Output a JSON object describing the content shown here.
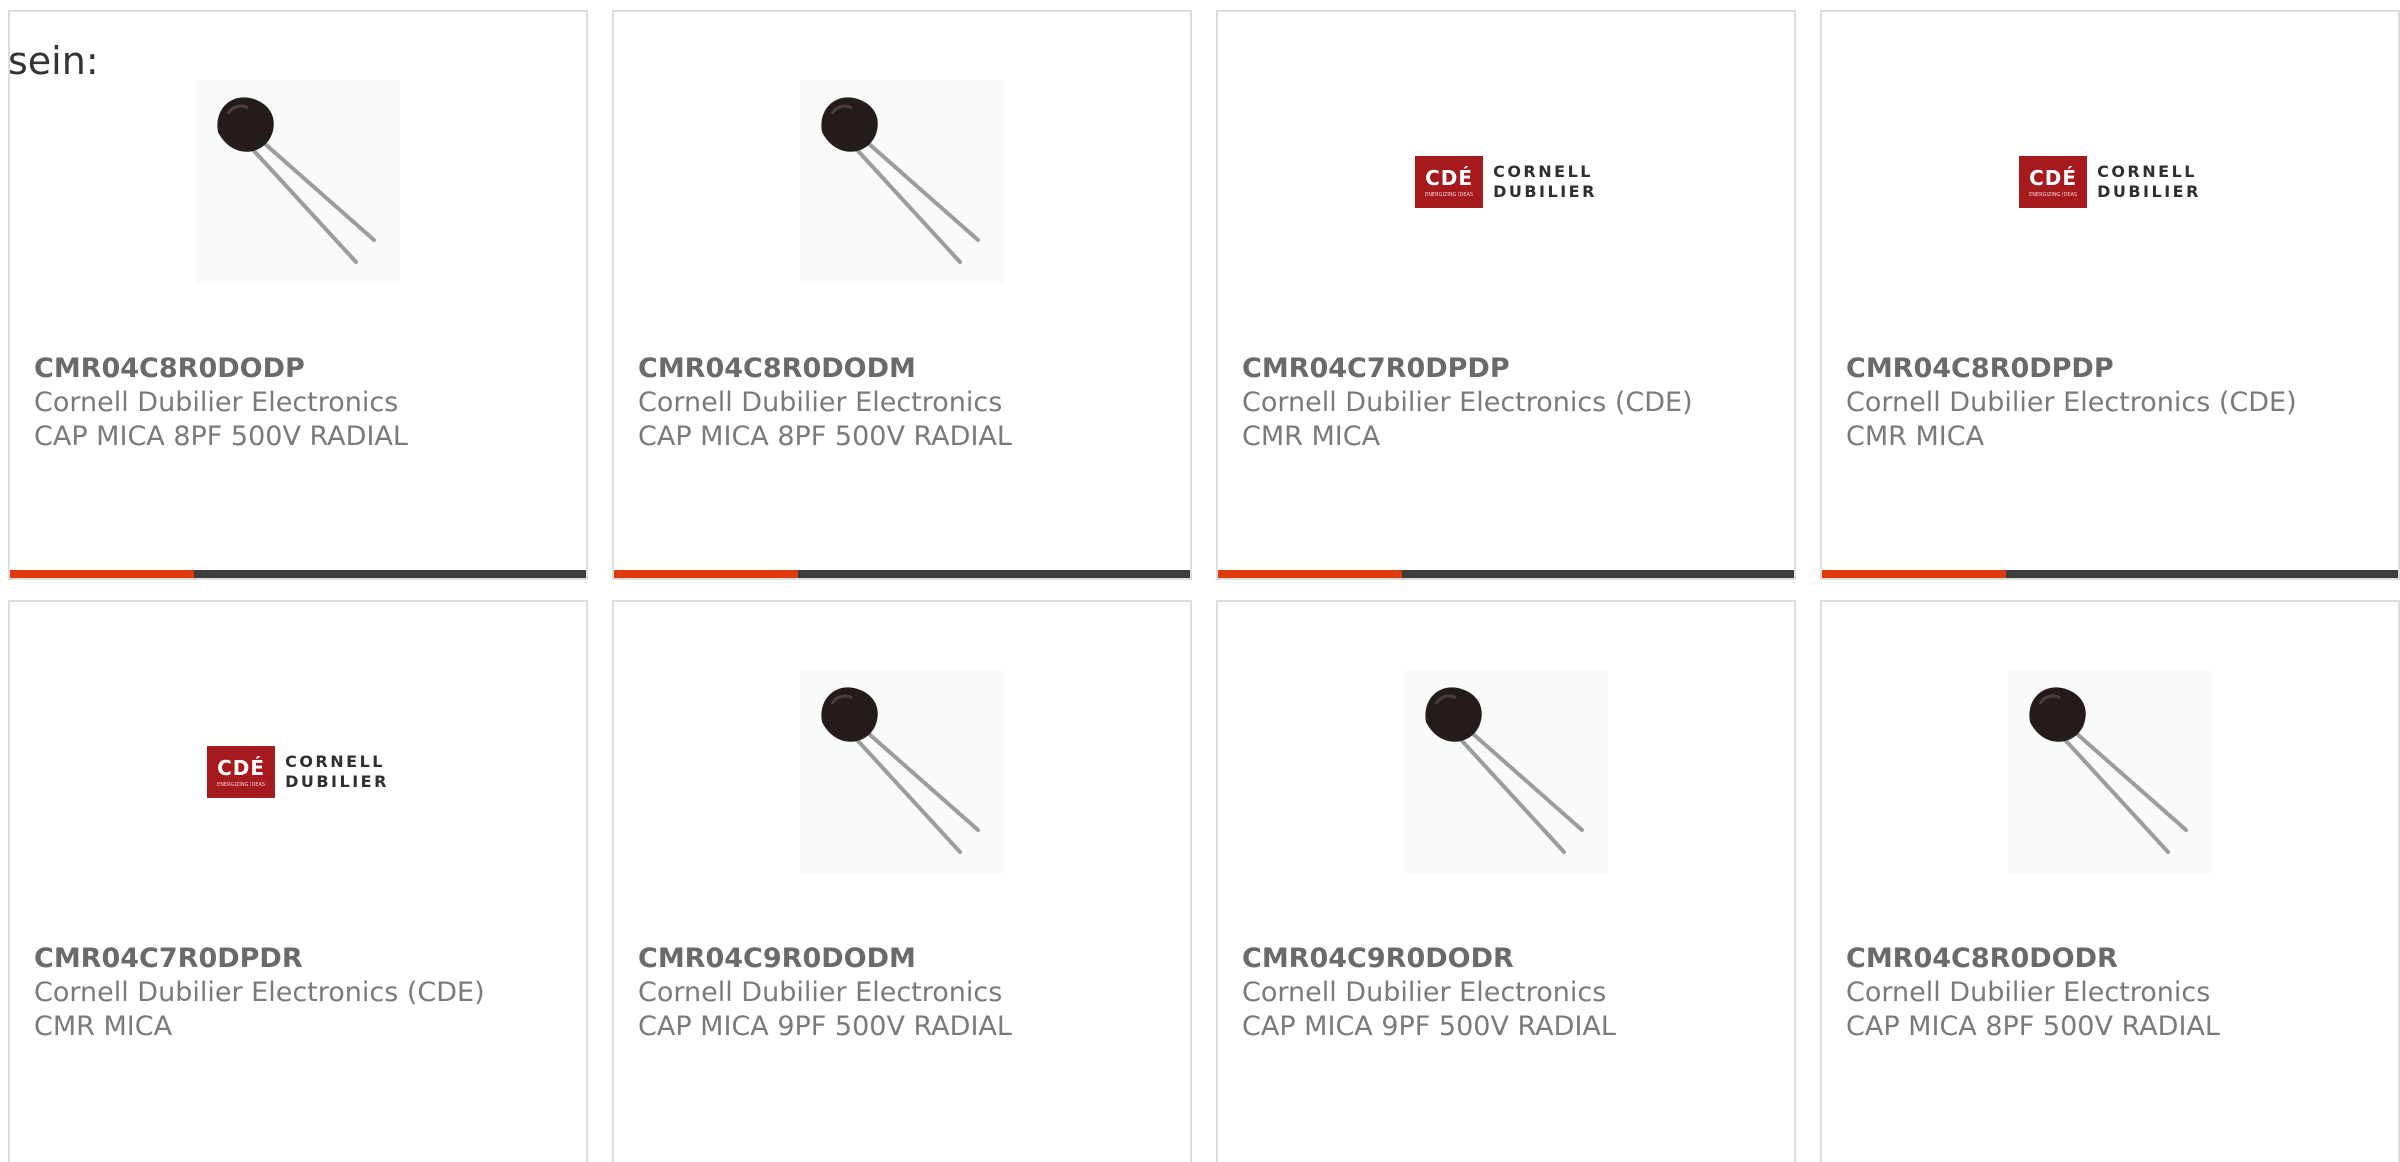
{
  "intro_text": "sein:",
  "colors": {
    "accent": "#e03a0c",
    "bar_track": "#3e3e3e",
    "logo_red": "#a6191c",
    "border": "#dddddd"
  },
  "logo": {
    "badge": "CDÉ",
    "tagline": "ENERGIZING IDEAS",
    "line1": "CORNELL",
    "line2": "DUBILIER"
  },
  "products": [
    {
      "part_number": "CMR04C8R0DODP",
      "manufacturer": "Cornell Dubilier Electronics",
      "description": "CAP MICA 8PF 500V RADIAL",
      "image": "capacitor-photo",
      "progress": 0.32
    },
    {
      "part_number": "CMR04C8R0DODM",
      "manufacturer": "Cornell Dubilier Electronics",
      "description": "CAP MICA 8PF 500V RADIAL",
      "image": "capacitor-photo",
      "progress": 0.32
    },
    {
      "part_number": "CMR04C7R0DPDP",
      "manufacturer": "Cornell Dubilier Electronics (CDE)",
      "description": "CMR MICA",
      "image": "cde-logo",
      "progress": 0.32
    },
    {
      "part_number": "CMR04C8R0DPDP",
      "manufacturer": "Cornell Dubilier Electronics (CDE)",
      "description": "CMR MICA",
      "image": "cde-logo",
      "progress": 0.32
    },
    {
      "part_number": "CMR04C7R0DPDR",
      "manufacturer": "Cornell Dubilier Electronics (CDE)",
      "description": "CMR MICA",
      "image": "cde-logo"
    },
    {
      "part_number": "CMR04C9R0DODM",
      "manufacturer": "Cornell Dubilier Electronics",
      "description": "CAP MICA 9PF 500V RADIAL",
      "image": "capacitor-photo"
    },
    {
      "part_number": "CMR04C9R0DODR",
      "manufacturer": "Cornell Dubilier Electronics",
      "description": "CAP MICA 9PF 500V RADIAL",
      "image": "capacitor-photo"
    },
    {
      "part_number": "CMR04C8R0DODR",
      "manufacturer": "Cornell Dubilier Electronics",
      "description": "CAP MICA 8PF 500V RADIAL",
      "image": "capacitor-photo"
    }
  ]
}
